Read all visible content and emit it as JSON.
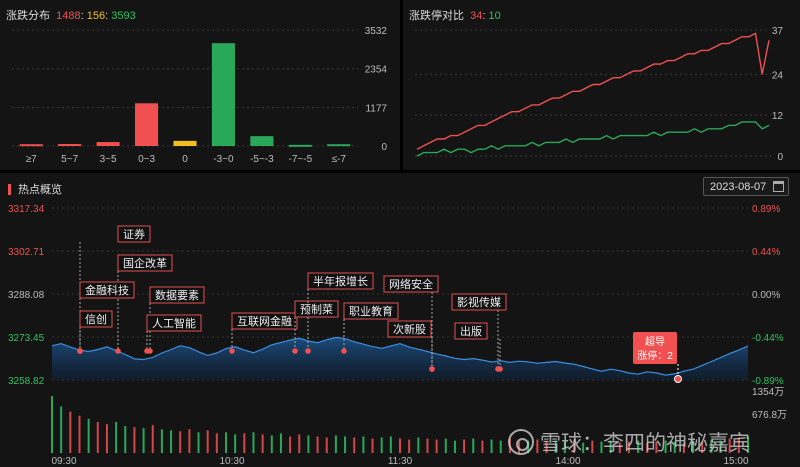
{
  "distribution": {
    "title": "涨跌分布",
    "up_count": "1488",
    "flat_count": "156",
    "down_count": "3593",
    "sep": ":",
    "colors": {
      "up": "#f05050",
      "flat": "#f0c020",
      "down": "#2aa85a"
    },
    "chart_data": {
      "type": "bar",
      "categories": [
        "≥7",
        "5~7",
        "3~5",
        "0~3",
        "0",
        "-3~0",
        "-5~-3",
        "-7~-5",
        "≤-7"
      ],
      "values": [
        55,
        60,
        120,
        1300,
        156,
        3130,
        300,
        35,
        55
      ],
      "ylim": [
        0,
        3532
      ],
      "yticks": [
        "3532",
        "2354",
        "1177",
        "0"
      ]
    }
  },
  "ratio": {
    "title": "涨跌停对比",
    "limit_up": "34",
    "limit_down": "10",
    "sep": ":",
    "chart_data": {
      "type": "line",
      "ylim": [
        0,
        37
      ],
      "yticks": [
        "37",
        "24",
        "12",
        "0"
      ],
      "series": [
        {
          "color": "#f05050",
          "values": [
            2,
            3,
            4,
            5,
            5,
            6,
            6,
            7,
            8,
            9,
            9,
            10,
            11,
            12,
            13,
            13,
            14,
            15,
            15,
            16,
            17,
            17,
            18,
            19,
            19,
            20,
            21,
            21,
            22,
            23,
            23,
            24,
            25,
            25,
            26,
            27,
            27,
            28,
            28,
            29,
            30,
            30,
            31,
            31,
            32,
            33,
            33,
            34,
            35,
            35,
            36,
            24,
            34
          ]
        },
        {
          "color": "#2aa85a",
          "values": [
            0,
            1,
            1,
            1,
            2,
            1,
            2,
            2,
            1,
            2,
            2,
            3,
            2,
            3,
            3,
            3,
            3,
            4,
            3,
            4,
            4,
            4,
            5,
            4,
            5,
            5,
            5,
            5,
            6,
            5,
            6,
            6,
            6,
            6,
            6,
            7,
            6,
            7,
            7,
            7,
            7,
            8,
            7,
            8,
            8,
            8,
            9,
            9,
            10,
            10,
            10,
            8,
            9
          ]
        }
      ]
    }
  },
  "hotspot": {
    "title": "热点概览",
    "date": "2023-08-07",
    "chart_data": {
      "type": "area",
      "ylim": [
        3258.82,
        3317.34
      ],
      "y_left_ticks": [
        "3317.34",
        "3302.71",
        "3288.08",
        "3273.45",
        "3258.82"
      ],
      "y_right_ticks": [
        "0.89%",
        "0.44%",
        "0.00%",
        "-0.44%",
        "-0.89%"
      ],
      "x_ticks": [
        "09:30",
        "10:30",
        "11:30",
        "14:00",
        "15:00"
      ],
      "volume_ticks": [
        "1354万",
        "676.8万"
      ],
      "values": [
        3270.5,
        3271.2,
        3270.0,
        3269.0,
        3268.5,
        3269.2,
        3270.1,
        3268.8,
        3267.5,
        3266.0,
        3265.8,
        3266.5,
        3268.0,
        3269.2,
        3270.5,
        3269.8,
        3268.4,
        3267.2,
        3268.0,
        3269.5,
        3270.1,
        3269.0,
        3268.1,
        3269.3,
        3270.8,
        3271.6,
        3272.4,
        3273.0,
        3272.1,
        3271.5,
        3272.5,
        3273.3,
        3272.9,
        3271.8,
        3271.0,
        3270.2,
        3269.6,
        3270.4,
        3271.2,
        3270.0,
        3269.3,
        3268.5,
        3267.7,
        3267.0,
        3266.2,
        3265.8,
        3266.1,
        3265.6,
        3264.9,
        3265.4,
        3264.8,
        3265.2,
        3265.0,
        3264.5,
        3264.8,
        3265.1,
        3264.6,
        3264.2,
        3263.4,
        3262.6,
        3261.8,
        3262.5,
        3262.0,
        3261.2,
        3260.8,
        3261.6,
        3261.2,
        3260.5,
        3260.9,
        3261.8,
        3262.5,
        3263.8,
        3265.1,
        3266.4,
        3267.8,
        3269.0,
        3270.4
      ],
      "volume": [
        55,
        45,
        40,
        36,
        33,
        30,
        28,
        30,
        26,
        25,
        24,
        27,
        23,
        22,
        21,
        23,
        20,
        22,
        19,
        20,
        18,
        19,
        20,
        18,
        17,
        19,
        16,
        18,
        17,
        16,
        15,
        17,
        16,
        15,
        16,
        14,
        15,
        16,
        14,
        13,
        15,
        14,
        13,
        14,
        12,
        13,
        14,
        12,
        13,
        12,
        14,
        11,
        12,
        13,
        11,
        12,
        11,
        13,
        10,
        12,
        11,
        12,
        10,
        11,
        12,
        10,
        11,
        12,
        11,
        10,
        12,
        11,
        13,
        12,
        14,
        15,
        16
      ]
    },
    "tags": [
      {
        "id": "zhengquan",
        "label": "证券"
      },
      {
        "id": "guoqi",
        "label": "国企改革"
      },
      {
        "id": "jinrong",
        "label": "金融科技"
      },
      {
        "id": "xinchuang",
        "label": "信创"
      },
      {
        "id": "shuju",
        "label": "数据要素"
      },
      {
        "id": "rengong",
        "label": "人工智能"
      },
      {
        "id": "hulian",
        "label": "互联网金融"
      },
      {
        "id": "yuzhicai",
        "label": "预制菜"
      },
      {
        "id": "bannian",
        "label": "半年报增长"
      },
      {
        "id": "zhiye",
        "label": "职业教育"
      },
      {
        "id": "wangluo",
        "label": "网络安全"
      },
      {
        "id": "cixingu",
        "label": "次新股"
      },
      {
        "id": "yingshi",
        "label": "影视传媒"
      },
      {
        "id": "chuban",
        "label": "出版"
      }
    ],
    "callout": {
      "line1": "超导",
      "line2": "涨停：2",
      "bg": "#f05050"
    }
  },
  "watermark": {
    "text": "雪球：李四的神秘嘉宾"
  }
}
